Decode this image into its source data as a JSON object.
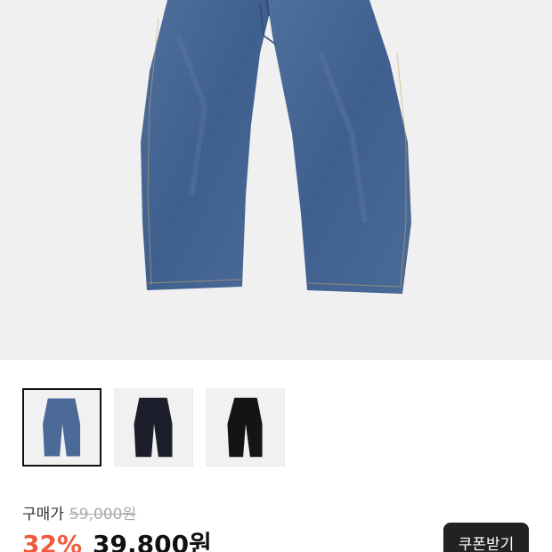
{
  "product": {
    "price_label": "구매가",
    "original_price": "59,000원",
    "discount_rate": "32%",
    "sale_price": "39,800원",
    "coupon_button_label": "쿠폰받기"
  },
  "thumbnails": [
    {
      "name": "denim-blue",
      "color": "#4b6a98",
      "selected": true
    },
    {
      "name": "dark-navy",
      "color": "#1c1f2b",
      "selected": false
    },
    {
      "name": "black",
      "color": "#141414",
      "selected": false
    }
  ],
  "colors": {
    "accent_discount": "#f05a3f",
    "button_bg": "#222222",
    "hero_bg": "#f0f0f0"
  }
}
